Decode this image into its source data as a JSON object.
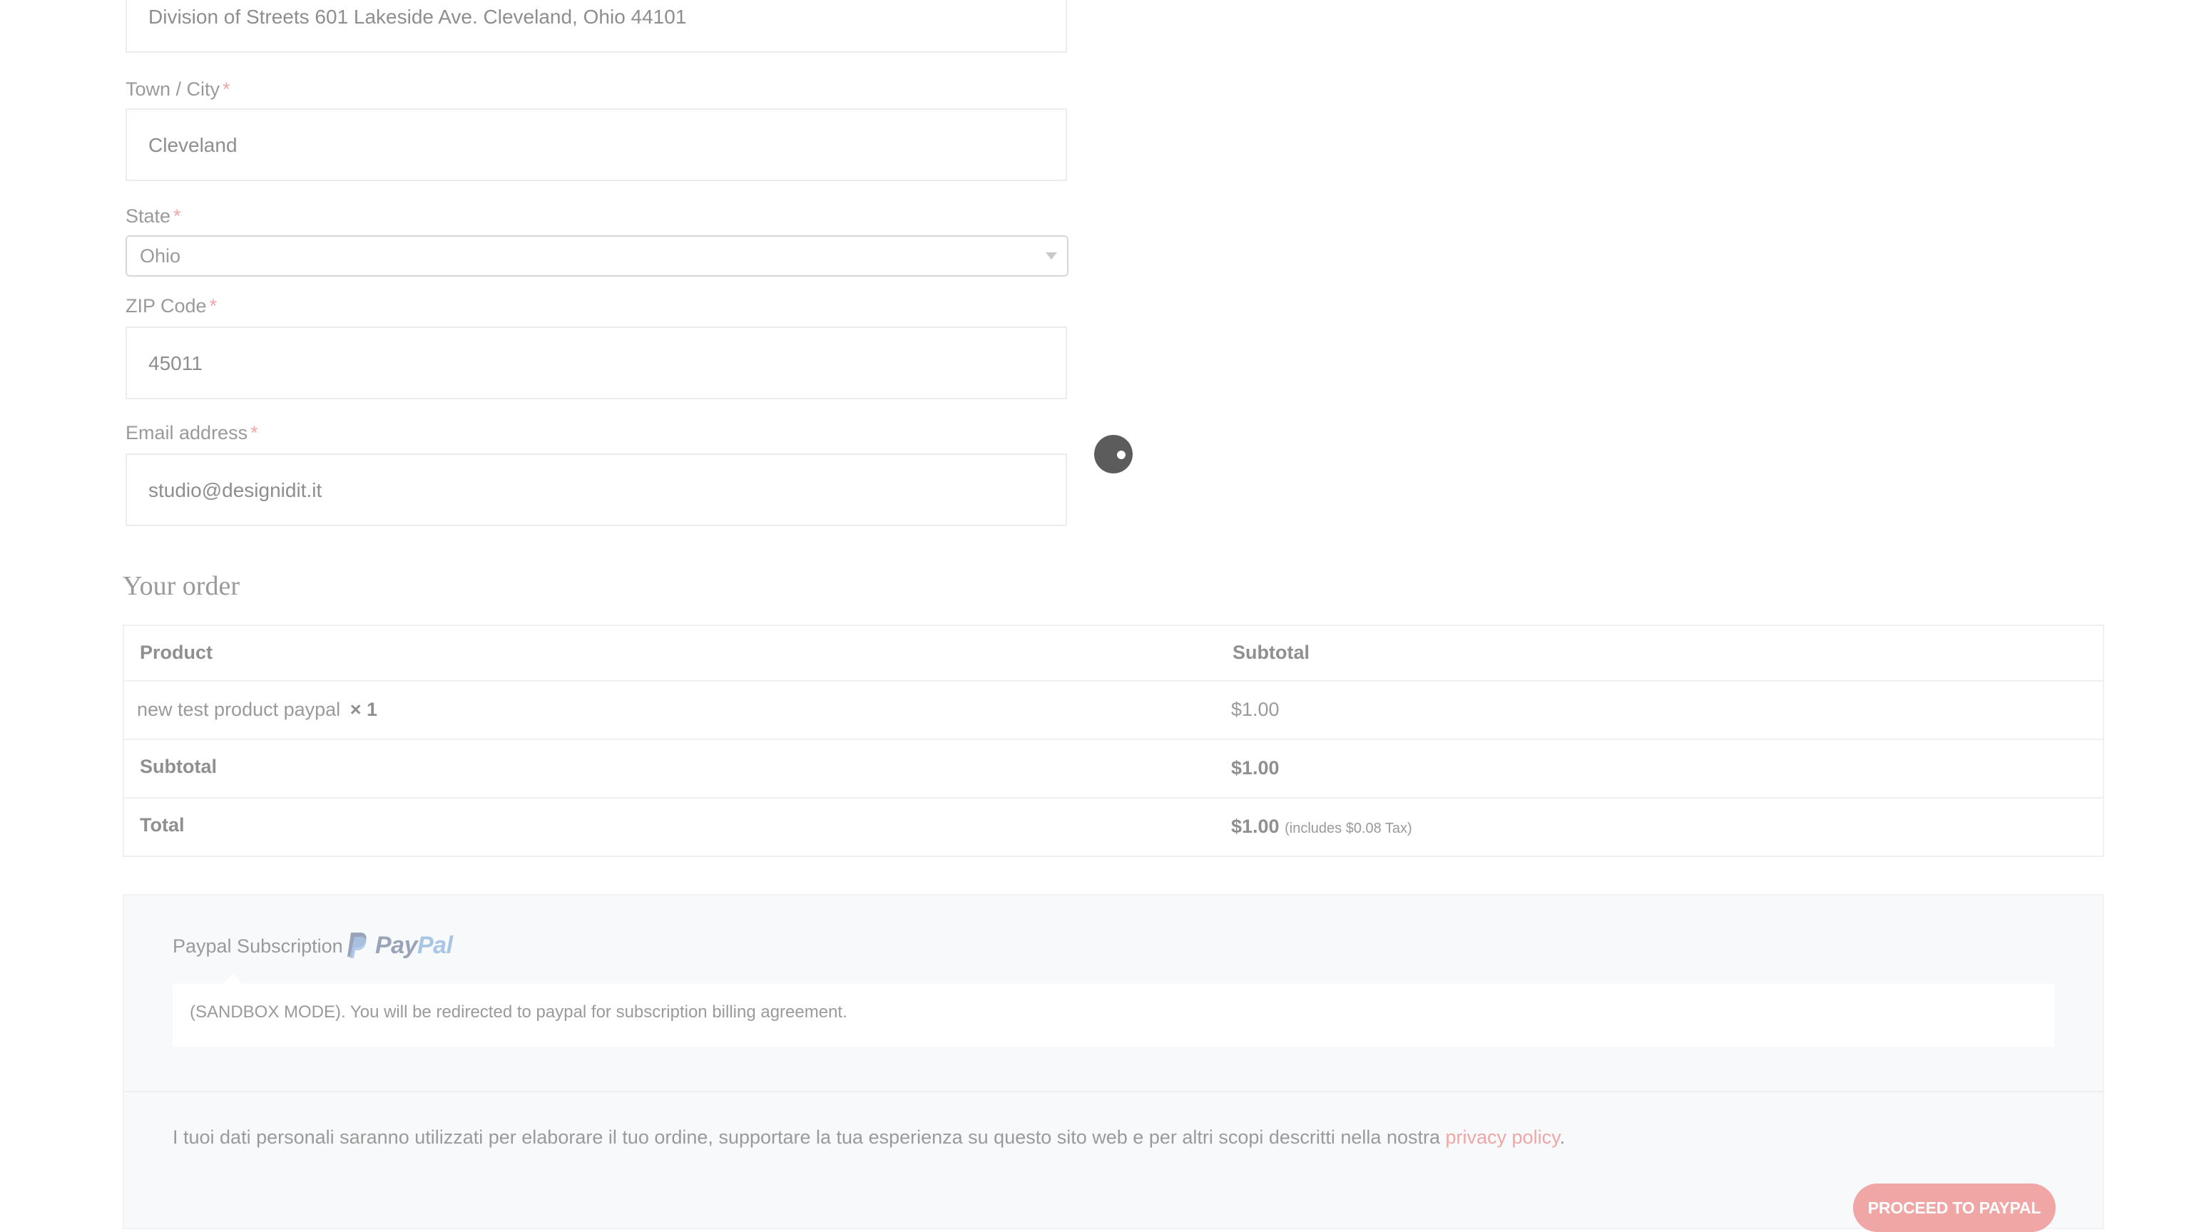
{
  "address_field": {
    "value": "Division of Streets 601 Lakeside Ave. Cleveland, Ohio 44101"
  },
  "town_city": {
    "label": "Town / City",
    "required_mark": "*",
    "value": "Cleveland"
  },
  "state": {
    "label": "State",
    "required_mark": "*",
    "value": "Ohio"
  },
  "zip_code": {
    "label": "ZIP Code",
    "required_mark": "*",
    "value": "45011"
  },
  "email": {
    "label": "Email address",
    "required_mark": "*",
    "value": "studio@designidit.it"
  },
  "order": {
    "heading": "Your order",
    "columns": {
      "product": "Product",
      "subtotal": "Subtotal"
    },
    "item": {
      "name": "new test product paypal",
      "quantity": "× 1",
      "price": "$1.00"
    },
    "subtotal_row": {
      "label": "Subtotal",
      "value": "$1.00"
    },
    "total_row": {
      "label": "Total",
      "value": "$1.00",
      "tax_note": "(includes $0.08 Tax)"
    }
  },
  "payment": {
    "method_label": "Paypal Subscription",
    "logo_text_pay": "Pay",
    "logo_text_pal": "Pal",
    "description": "(SANDBOX MODE). You will be redirected to paypal for subscription billing agreement.",
    "privacy_text": "I tuoi dati personali saranno utilizzati per elaborare il tuo ordine, supportare la tua esperienza su questo sito web e per altri scopi descritti nella nostra",
    "privacy_link": "privacy policy",
    "privacy_end": ".",
    "button_label": "PROCEED TO PAYPAL"
  },
  "colors": {
    "accent": "#f1a6a6",
    "required": "#f0a6a6",
    "paypal_dark": "#9aa4b8",
    "paypal_light": "#a9c5e6"
  },
  "icons": {
    "select_arrow": "chevron-down-icon",
    "loader": "loading-spinner-icon",
    "paypal": "paypal-logo"
  }
}
